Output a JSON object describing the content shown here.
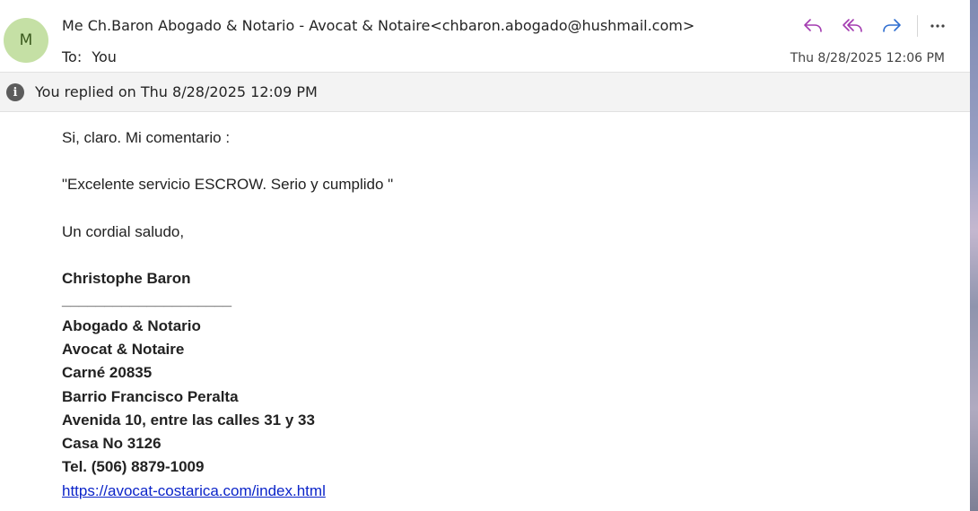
{
  "header": {
    "avatar_initial": "M",
    "sender": "Me Ch.Baron Abogado & Notario - Avocat & Notaire<chbaron.abogado@hushmail.com>",
    "to_label": "To:",
    "to_value": "You",
    "timestamp": "Thu 8/28/2025 12:06 PM",
    "actions": {
      "reply_icon": "reply-icon",
      "reply_all_icon": "reply-all-icon",
      "forward_icon": "forward-icon",
      "more_icon": "more-icon",
      "more_label": "···"
    },
    "colors": {
      "reply_accent": "#a33bb0",
      "forward_accent": "#2f6ed0",
      "avatar_bg": "#c5e0a5"
    }
  },
  "infobar": {
    "icon": "info-icon",
    "icon_glyph": "i",
    "text": "You replied on Thu 8/28/2025 12:09 PM"
  },
  "body": {
    "line1": "Si, claro. Mi comentario :",
    "line2": "\"Excelente servicio ESCROW. Serio y cumplido \"",
    "line3": "Un cordial saludo,",
    "signature_name": "Christophe Baron",
    "signature_rule": "____________________",
    "sig_lines": [
      "Abogado & Notario",
      "Avocat & Notaire",
      "Carné 20835",
      "Barrio Francisco Peralta",
      "Avenida 10, entre las calles 31 y 33",
      "Casa No 3126",
      "Tel. (506) 8879-1009"
    ],
    "link": "https://avocat-costarica.com/index.html"
  }
}
